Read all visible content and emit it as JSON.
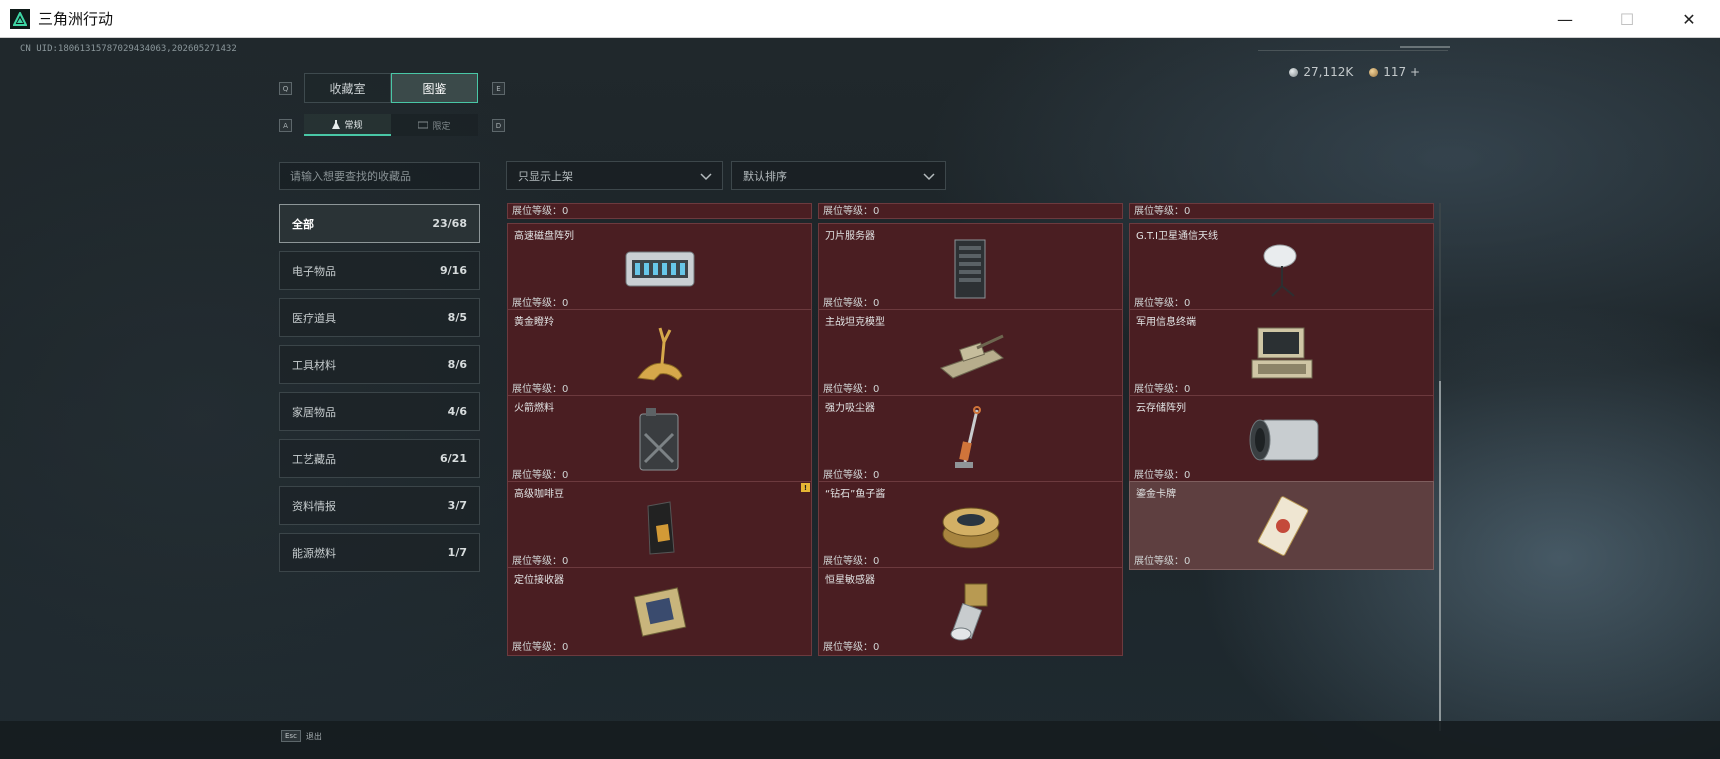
{
  "window": {
    "title": "三角洲行动",
    "minimize": "—",
    "maximize": "☐",
    "close": "✕"
  },
  "header": {
    "uid": "CN UID:18061315787029434063,202605271432",
    "currency": [
      {
        "icon": "silver-coin-icon",
        "value": "27,112K",
        "color": "#b9c0c3"
      },
      {
        "icon": "gold-coin-icon",
        "value": "117 +",
        "color": "#c9a46a"
      }
    ]
  },
  "keys": {
    "tab_prev": "Q",
    "tab_next": "E",
    "sub_prev": "A",
    "sub_next": "D"
  },
  "tabs": [
    {
      "label": "收藏室",
      "active": false
    },
    {
      "label": "图鉴",
      "active": true
    }
  ],
  "subtabs": [
    {
      "label": "常规",
      "active": true
    },
    {
      "label": "限定",
      "active": false
    }
  ],
  "search": {
    "placeholder": "请输入想要查找的收藏品"
  },
  "filters": {
    "shelf": "只显示上架",
    "sort": "默认排序"
  },
  "categories": [
    {
      "label": "全部",
      "count": "23/68",
      "active": true
    },
    {
      "label": "电子物品",
      "count": "9/16",
      "active": false
    },
    {
      "label": "医疗道具",
      "count": "8/5",
      "active": false
    },
    {
      "label": "工具材料",
      "count": "8/6",
      "active": false
    },
    {
      "label": "家居物品",
      "count": "4/6",
      "active": false
    },
    {
      "label": "工艺藏品",
      "count": "6/21",
      "active": false
    },
    {
      "label": "资料情报",
      "count": "3/7",
      "active": false
    },
    {
      "label": "能源燃料",
      "count": "1/7",
      "active": false
    }
  ],
  "partial_row": [
    {
      "level": "展位等级：0"
    },
    {
      "level": "展位等级：0"
    },
    {
      "level": "展位等级：0"
    }
  ],
  "items": [
    {
      "name": "高速磁盘阵列",
      "level": "展位等级：0",
      "icon": "disk-array-icon"
    },
    {
      "name": "刀片服务器",
      "level": "展位等级：0",
      "icon": "blade-server-icon"
    },
    {
      "name": "G.T.I卫星通信天线",
      "level": "展位等级：0",
      "icon": "satellite-antenna-icon"
    },
    {
      "name": "黄金瞪羚",
      "level": "展位等级：0",
      "icon": "golden-gazelle-icon"
    },
    {
      "name": "主战坦克模型",
      "level": "展位等级：0",
      "icon": "tank-model-icon"
    },
    {
      "name": "军用信息终端",
      "level": "展位等级：0",
      "icon": "military-terminal-icon"
    },
    {
      "name": "火箭燃料",
      "level": "展位等级：0",
      "icon": "fuel-canister-icon"
    },
    {
      "name": "强力吸尘器",
      "level": "展位等级：0",
      "icon": "vacuum-cleaner-icon"
    },
    {
      "name": "云存储阵列",
      "level": "展位等级：0",
      "icon": "cloud-storage-icon"
    },
    {
      "name": "高级咖啡豆",
      "level": "展位等级：0",
      "icon": "coffee-bag-icon",
      "badge": "!"
    },
    {
      "name": "“钻石”鱼子酱",
      "level": "展位等级：0",
      "icon": "caviar-tin-icon"
    },
    {
      "name": "鎏金卡牌",
      "level": "展位等级：0",
      "icon": "gilded-card-icon",
      "light": true
    },
    {
      "name": "定位接收器",
      "level": "展位等级：0",
      "icon": "gps-receiver-icon"
    },
    {
      "name": "恒星敏感器",
      "level": "展位等级：0",
      "icon": "star-sensor-icon"
    }
  ],
  "footer": {
    "key": "Esc",
    "label": "退出"
  }
}
